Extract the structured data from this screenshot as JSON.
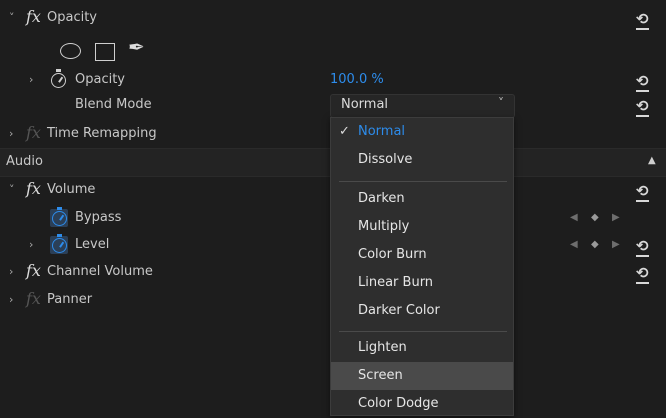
{
  "opacity_effect": {
    "name": "Opacity",
    "fx_symbol": "fx",
    "property_opacity": {
      "label": "Opacity",
      "value": "100.0 %"
    },
    "blend_mode": {
      "label": "Blend Mode",
      "value": "Normal"
    }
  },
  "time_remapping": {
    "label": "Time Remapping"
  },
  "audio": {
    "section_label": "Audio",
    "volume": {
      "name": "Volume",
      "bypass_label": "Bypass",
      "level_label": "Level"
    },
    "channel_volume": {
      "name": "Channel Volume"
    },
    "panner": {
      "name": "Panner"
    }
  },
  "blend_menu": {
    "items": [
      "Normal",
      "Dissolve",
      "Darken",
      "Multiply",
      "Color Burn",
      "Linear Burn",
      "Darker Color",
      "Lighten",
      "Screen",
      "Color Dodge"
    ],
    "selected": "Normal",
    "hovered": "Screen"
  },
  "icons": {
    "chevron_down": "˅",
    "chevron_right": "›",
    "reset": "⟲",
    "checkmark": "✓",
    "pen": "✒",
    "kf_prev": "◀",
    "kf_add": "◆",
    "kf_next": "▶",
    "collapse": "▲"
  },
  "colors": {
    "accent_blue": "#2d8ceb",
    "background": "#1d1d1d",
    "menu_bg": "#2e2e2e",
    "hover_bg": "#4a4a4a"
  }
}
